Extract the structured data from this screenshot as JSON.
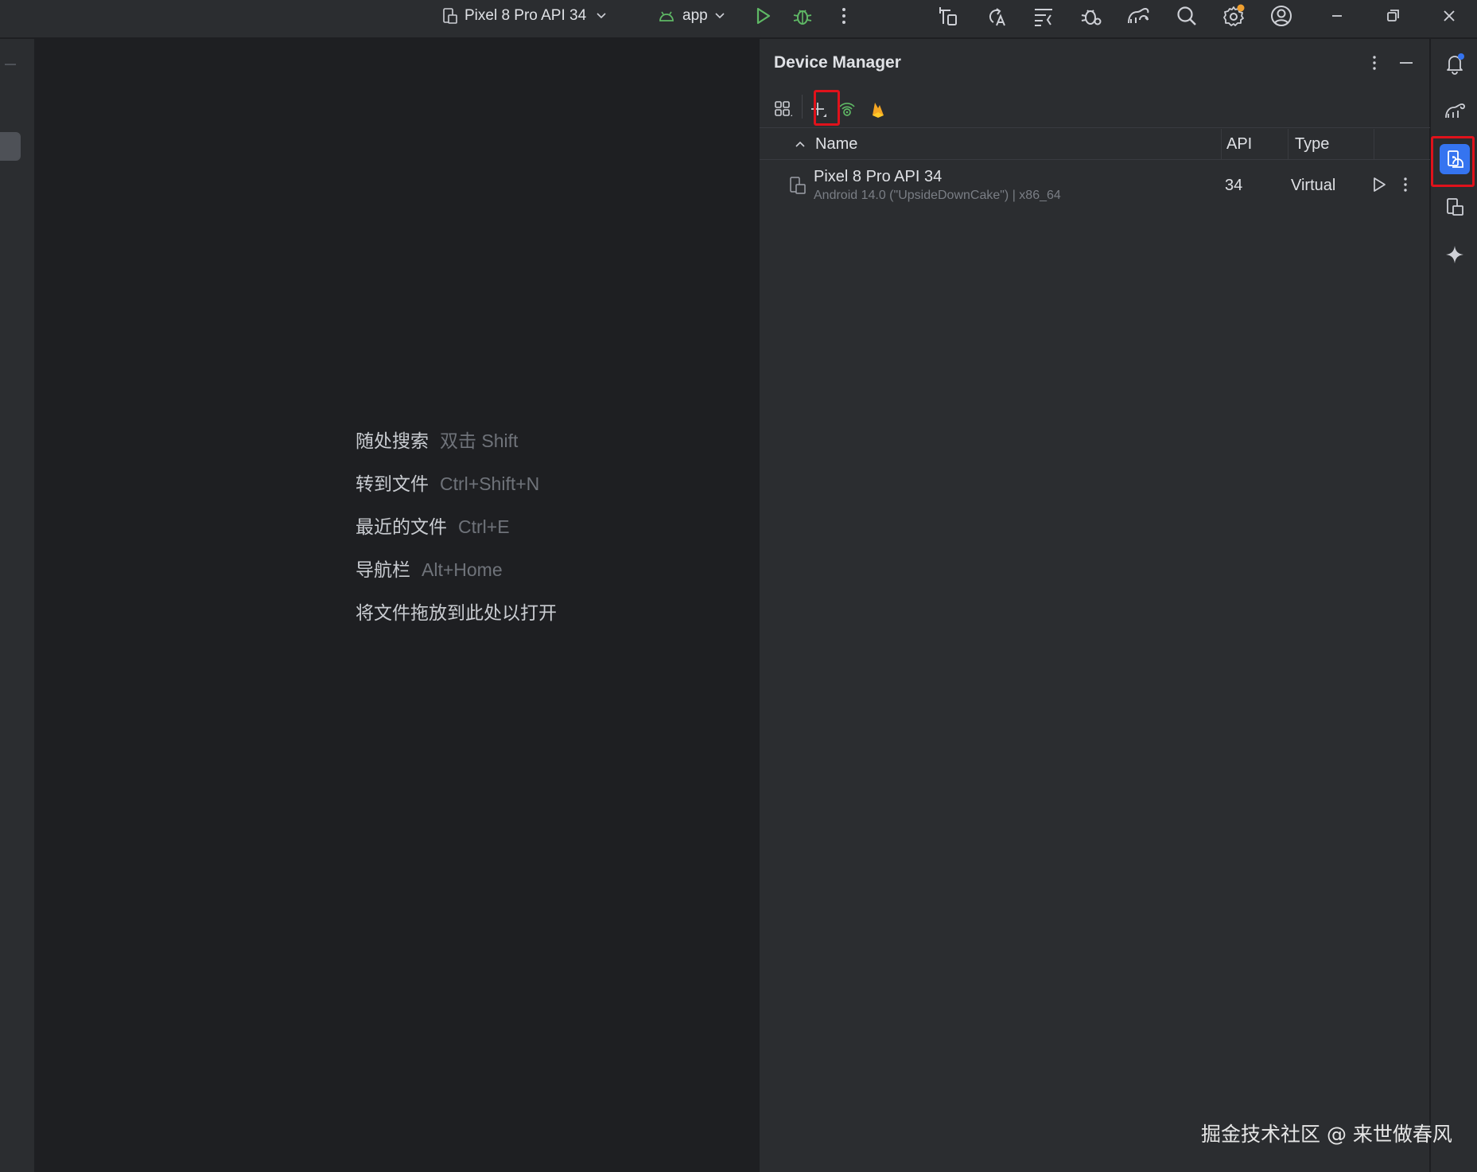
{
  "titlebar": {
    "device_selector": "Pixel 8 Pro API 34",
    "run_config": "app"
  },
  "editor": {
    "hints": [
      {
        "label": "随处搜索",
        "key": "双击 Shift"
      },
      {
        "label": "转到文件",
        "key": "Ctrl+Shift+N"
      },
      {
        "label": "最近的文件",
        "key": "Ctrl+E"
      },
      {
        "label": "导航栏",
        "key": "Alt+Home"
      },
      {
        "label": "将文件拖放到此处以打开",
        "key": ""
      }
    ]
  },
  "device_manager": {
    "title": "Device Manager",
    "columns": {
      "name": "Name",
      "api": "API",
      "type": "Type"
    },
    "devices": [
      {
        "name": "Pixel 8 Pro API 34",
        "details": "Android 14.0 (\"UpsideDownCake\") | x86_64",
        "api": "34",
        "type": "Virtual"
      }
    ]
  },
  "colors": {
    "run_green": "#5fb865",
    "accent_blue": "#3574f0",
    "highlight_red": "#e0121b",
    "firebase_orange": "#f5a623",
    "badge_orange": "#f0a030"
  },
  "watermark": "掘金技术社区 @ 来世做春风"
}
